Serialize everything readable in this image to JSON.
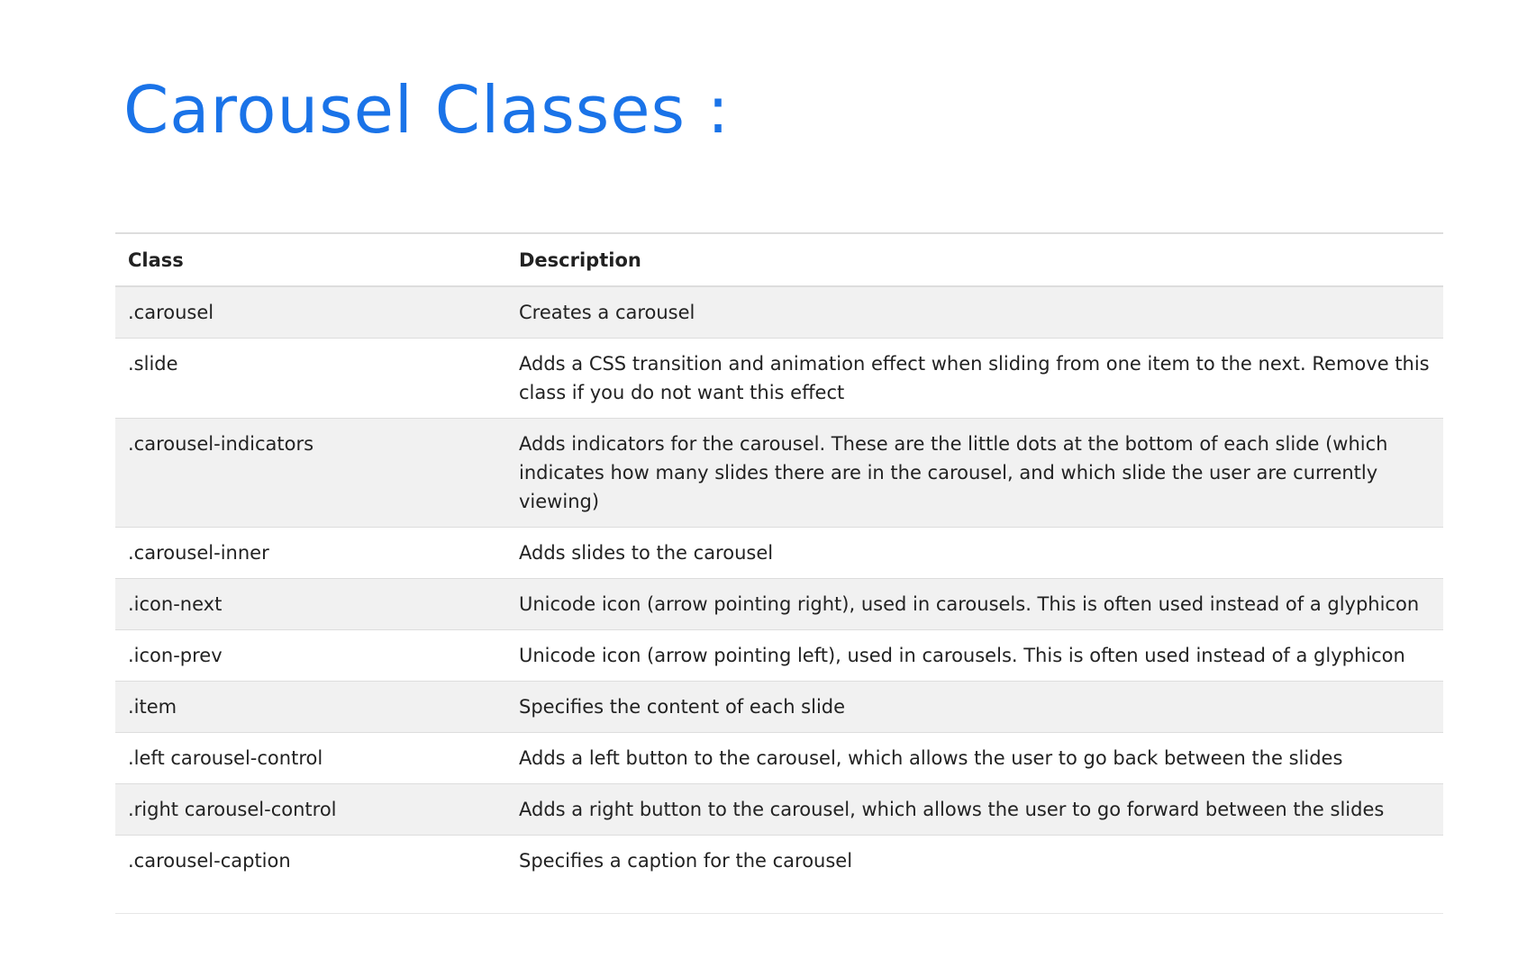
{
  "title": "Carousel Classes :",
  "table": {
    "headers": [
      "Class",
      "Description"
    ],
    "rows": [
      {
        "class": ".carousel",
        "description": "Creates a carousel"
      },
      {
        "class": ".slide",
        "description": "Adds a CSS transition and animation effect when sliding from one item to the next. Remove this class if you do not want this effect"
      },
      {
        "class": ".carousel-indicators",
        "description": "Adds indicators for the carousel. These are the little dots at the bottom of each slide (which indicates how many slides there are in the carousel, and which slide the user are currently viewing)"
      },
      {
        "class": ".carousel-inner",
        "description": "Adds slides to the carousel"
      },
      {
        "class": ".icon-next",
        "description": "Unicode icon (arrow pointing right), used in carousels. This is often used instead of a glyphicon"
      },
      {
        "class": ".icon-prev",
        "description": "Unicode icon (arrow pointing left), used in carousels. This is often used instead of a glyphicon"
      },
      {
        "class": ".item",
        "description": "Specifies the content of each slide"
      },
      {
        "class": ".left carousel-control",
        "description": "Adds a left button to the carousel, which allows the user to go back between the slides"
      },
      {
        "class": ".right carousel-control",
        "description": "Adds a right button to the carousel, which allows the user to go forward between the slides"
      },
      {
        "class": ".carousel-caption",
        "description": "Specifies a caption for the carousel"
      }
    ]
  }
}
